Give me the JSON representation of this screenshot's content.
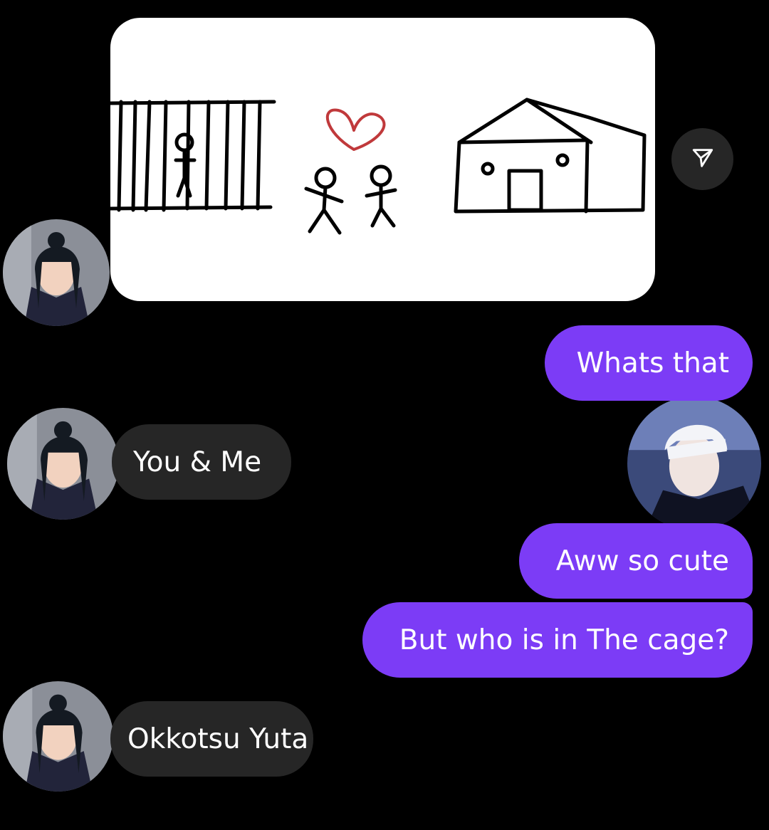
{
  "conversation": {
    "shared_image": {
      "description_icon": "stick-figure-drawing"
    },
    "share_icon": "paper-plane-icon",
    "messages": [
      {
        "from": "them",
        "text": "You & Me"
      },
      {
        "from": "me",
        "text": "Whats that"
      },
      {
        "from": "me",
        "text": "Aww so cute"
      },
      {
        "from": "me",
        "text": "But who is in The cage?"
      },
      {
        "from": "them",
        "text": "Okkotsu Yuta"
      }
    ]
  },
  "colors": {
    "background": "#000000",
    "incoming_bubble": "#262626",
    "outgoing_bubble": "#7c3cf6",
    "text": "#ffffff"
  }
}
